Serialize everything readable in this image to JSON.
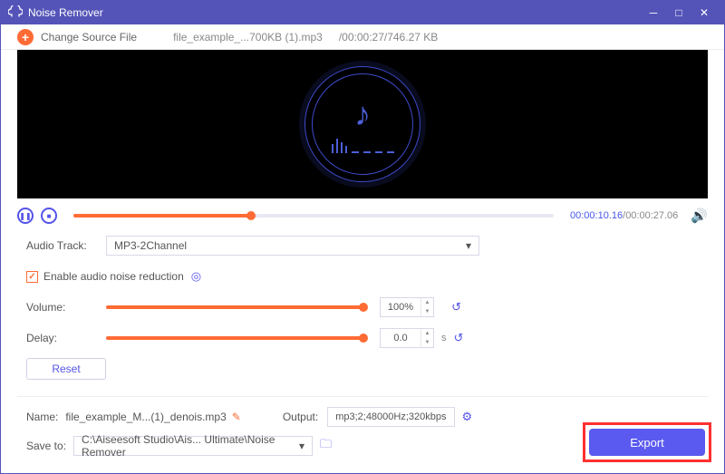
{
  "title": "Noise Remover",
  "topbar": {
    "change_source": "Change Source File",
    "file_name": "file_example_...700KB (1).mp3",
    "file_meta": "/00:00:27/746.27 KB"
  },
  "player": {
    "current_time": "00:00:10.16",
    "total_time": "00:00:27.06",
    "progress_pct": 37
  },
  "settings": {
    "audio_track_label": "Audio Track:",
    "audio_track_value": "MP3-2Channel",
    "noise_label": "Enable audio noise reduction",
    "volume_label": "Volume:",
    "volume_value": "100%",
    "delay_label": "Delay:",
    "delay_value": "0.0",
    "delay_unit": "s",
    "reset_label": "Reset"
  },
  "output": {
    "name_label": "Name:",
    "name_value": "file_example_M...(1)_denois.mp3",
    "output_label": "Output:",
    "output_value": "mp3;2;48000Hz;320kbps",
    "saveto_label": "Save to:",
    "saveto_value": "C:\\Aiseesoft Studio\\Ais... Ultimate\\Noise Remover",
    "export_label": "Export"
  }
}
